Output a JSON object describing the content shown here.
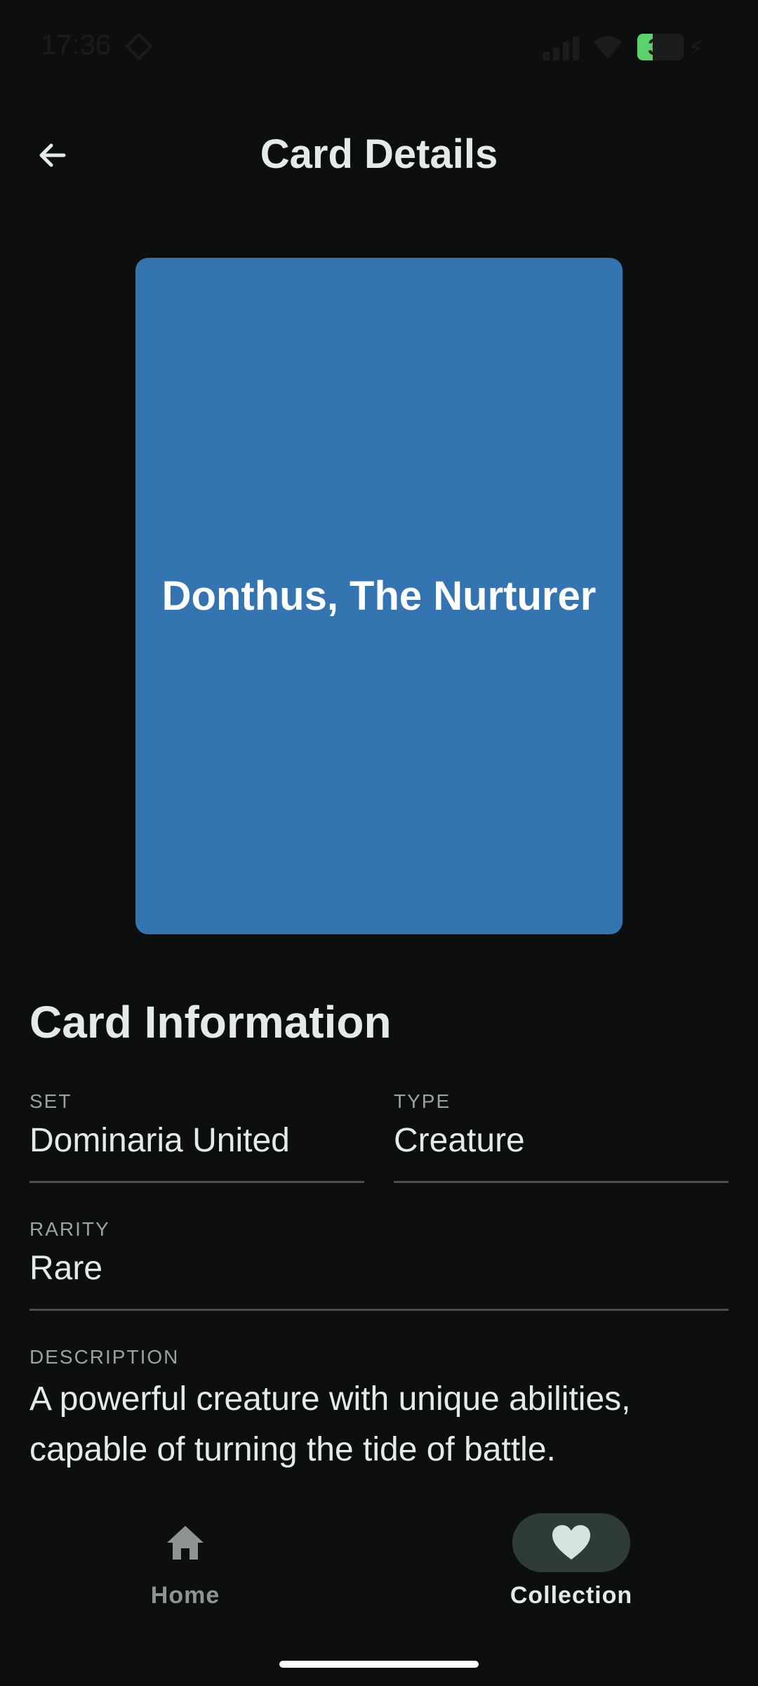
{
  "status_bar": {
    "time": "17:36",
    "battery": "34",
    "battery_level_percent": 34
  },
  "header": {
    "title": "Card Details",
    "back_icon": "arrow-left-icon"
  },
  "card": {
    "name": "Donthus, The Nurturer",
    "color": "#3474b0"
  },
  "info": {
    "section_title": "Card Information",
    "set_label": "SET",
    "set_value": "Dominaria United",
    "type_label": "TYPE",
    "type_value": "Creature",
    "rarity_label": "RARITY",
    "rarity_value": "Rare",
    "description_label": "DESCRIPTION",
    "description_value": "A powerful creature with unique abilities, capable of turning the tide of battle."
  },
  "bottom_nav": {
    "items": [
      {
        "label": "Home",
        "icon": "home-icon",
        "active": false
      },
      {
        "label": "Collection",
        "icon": "heart-icon",
        "active": true
      }
    ]
  }
}
